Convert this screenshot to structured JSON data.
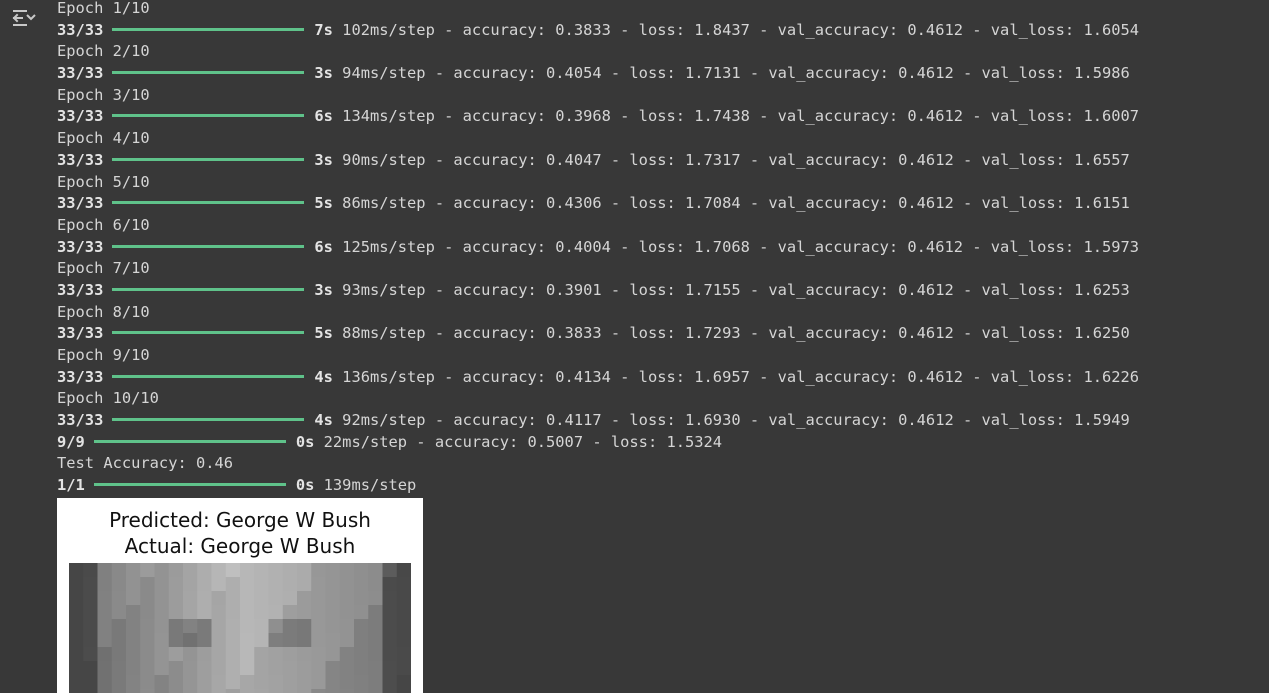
{
  "toolbar": {
    "toggle_icon": "output-collapse-icon"
  },
  "training": {
    "epochs": [
      {
        "epoch": "Epoch 1/10",
        "steps": "33/33",
        "time": "7s",
        "rest": "102ms/step - accuracy: 0.3833 - loss: 1.8437 - val_accuracy: 0.4612 - val_loss: 1.6054"
      },
      {
        "epoch": "Epoch 2/10",
        "steps": "33/33",
        "time": "3s",
        "rest": "94ms/step - accuracy: 0.4054 - loss: 1.7131 - val_accuracy: 0.4612 - val_loss: 1.5986"
      },
      {
        "epoch": "Epoch 3/10",
        "steps": "33/33",
        "time": "6s",
        "rest": "134ms/step - accuracy: 0.3968 - loss: 1.7438 - val_accuracy: 0.4612 - val_loss: 1.6007"
      },
      {
        "epoch": "Epoch 4/10",
        "steps": "33/33",
        "time": "3s",
        "rest": "90ms/step - accuracy: 0.4047 - loss: 1.7317 - val_accuracy: 0.4612 - val_loss: 1.6557"
      },
      {
        "epoch": "Epoch 5/10",
        "steps": "33/33",
        "time": "5s",
        "rest": "86ms/step - accuracy: 0.4306 - loss: 1.7084 - val_accuracy: 0.4612 - val_loss: 1.6151"
      },
      {
        "epoch": "Epoch 6/10",
        "steps": "33/33",
        "time": "6s",
        "rest": "125ms/step - accuracy: 0.4004 - loss: 1.7068 - val_accuracy: 0.4612 - val_loss: 1.5973"
      },
      {
        "epoch": "Epoch 7/10",
        "steps": "33/33",
        "time": "3s",
        "rest": "93ms/step - accuracy: 0.3901 - loss: 1.7155 - val_accuracy: 0.4612 - val_loss: 1.6253"
      },
      {
        "epoch": "Epoch 8/10",
        "steps": "33/33",
        "time": "5s",
        "rest": "88ms/step - accuracy: 0.3833 - loss: 1.7293 - val_accuracy: 0.4612 - val_loss: 1.6250"
      },
      {
        "epoch": "Epoch 9/10",
        "steps": "33/33",
        "time": "4s",
        "rest": "136ms/step - accuracy: 0.4134 - loss: 1.6957 - val_accuracy: 0.4612 - val_loss: 1.6226"
      },
      {
        "epoch": "Epoch 10/10",
        "steps": "33/33",
        "time": "4s",
        "rest": "92ms/step - accuracy: 0.4117 - loss: 1.6930 - val_accuracy: 0.4612 - val_loss: 1.5949"
      }
    ],
    "progress_fraction": 1.0,
    "progress_color": "#5fc28a"
  },
  "evaluation": {
    "steps": "9/9",
    "time": "0s",
    "rest": "22ms/step - accuracy: 0.5007 - loss: 1.5324",
    "test_accuracy": "Test Accuracy: 0.46"
  },
  "prediction": {
    "steps": "1/1",
    "time": "0s",
    "rest": "139ms/step"
  },
  "figure": {
    "title_line1": "Predicted: George W Bush",
    "title_line2": "Actual: George W Bush"
  }
}
